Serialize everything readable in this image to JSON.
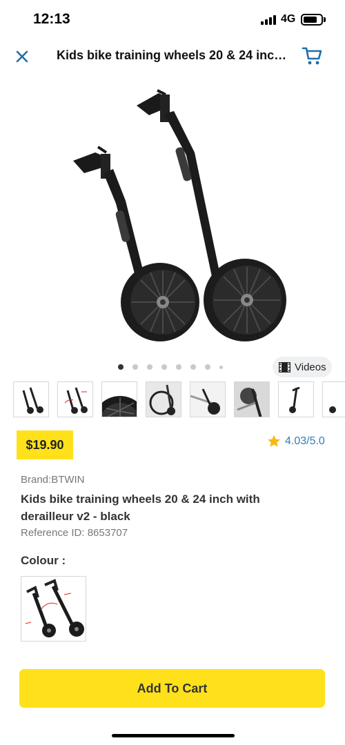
{
  "status_bar": {
    "time": "12:13",
    "network": "4G"
  },
  "header": {
    "title": "Kids bike training wheels 20 & 24 inch...",
    "close_icon": "close-icon",
    "cart_icon": "cart-icon"
  },
  "gallery": {
    "videos_label": "Videos",
    "dot_count": 8,
    "active_dot": 0
  },
  "product": {
    "price": "$19.90",
    "rating": "4.03/5.0",
    "brand": "Brand:BTWIN",
    "name": "Kids bike training wheels 20 & 24 inch with derailleur v2 - black",
    "reference": "Reference ID: 8653707"
  },
  "colour": {
    "label": "Colour :"
  },
  "actions": {
    "add_to_cart": "Add To Cart"
  },
  "colors": {
    "accent_yellow": "#ffe11b",
    "link_blue": "#2f7fb5",
    "icon_blue": "#1f6fa8"
  }
}
